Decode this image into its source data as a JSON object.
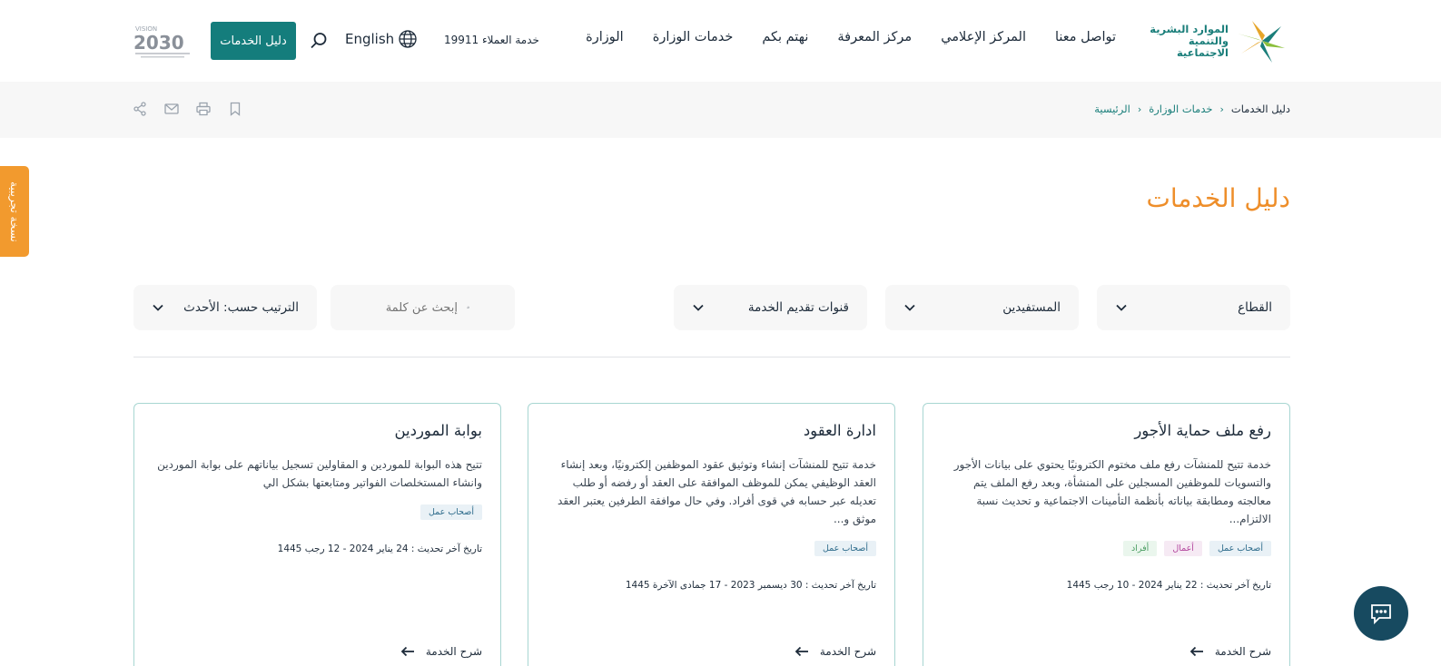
{
  "header": {
    "logo_line1": "الموارد البشرية",
    "logo_line2": "والتنمية الاجتماعية",
    "nav": [
      "الوزارة",
      "خدمات الوزارة",
      "نهتم بكم",
      "مركز المعرفة",
      "المركز الإعلامي",
      "تواصل معنا"
    ],
    "hotline": "خدمة العملاء 19911",
    "language": "English",
    "guide_button": "دليل الخدمات",
    "vision_icon": "vision-2030-logo"
  },
  "breadcrumb": {
    "home": "الرئيسية",
    "services": "خدمات الوزارة",
    "current": "دليل الخدمات"
  },
  "side_tab": "نسخة تجريبية",
  "page_title": "دليل الخدمات",
  "filters": {
    "sector": "القطاع",
    "beneficiaries": "المستفيدين",
    "channels": "قنوات تقديم الخدمة",
    "search_placeholder": "إبحث عن كلمة",
    "sort": "الترتيب حسب: الأحدث"
  },
  "cards": [
    {
      "title": "رفع ملف حماية الأجور",
      "description": "خدمة تتيح للمنشآت رفع ملف مختوم الكترونيًا يحتوي على بيانات الأجور والتسويات للموظفين المسجلين على المنشأة، وبعد رفع الملف يتم معالجته ومطابقة بياناته بأنظمة التأمينات الاجتماعية و تحديث نسبة الالتزام...",
      "tags": [
        "أصحاب عمل",
        "أعمال",
        "أفراد"
      ],
      "date": "تاريخ آخر تحديث : 22 يناير 2024 - 10 رجب 1445",
      "link": "شرح الخدمة"
    },
    {
      "title": "ادارة العقود",
      "description": "خدمة تتيح للمنشآت إنشاء وتوثيق عقود الموظفين إلكترونيًا، وبعد إنشاء العقد الوظيفي يمكن للموظف الموافقة على العقد أو رفضه أو طلب تعديله عبر حسابه في قوى أفراد. وفي حال موافقة الطرفين يعتبر العقد موثق و...",
      "tags": [
        "أصحاب عمل"
      ],
      "date": "تاريخ آخر تحديث : 30 ديسمبر 2023 - 17 جمادى الآخرة 1445",
      "link": "شرح الخدمة"
    },
    {
      "title": "بوابة الموردين",
      "description": "تتيح هذه البوابة للموردين و المقاولين تسجيل بياناتهم على بوابة الموردين وانشاء المستخلصات الفواتير ومتابعتها بشكل الي",
      "tags": [
        "أصحاب عمل"
      ],
      "date": "تاريخ آخر تحديث : 24 يناير 2024 - 12 رجب 1445",
      "link": "شرح الخدمة"
    }
  ],
  "colors": {
    "brand_teal": "#147d7c",
    "title_orange": "#ee8e2a",
    "chat_navy": "#174a60"
  }
}
